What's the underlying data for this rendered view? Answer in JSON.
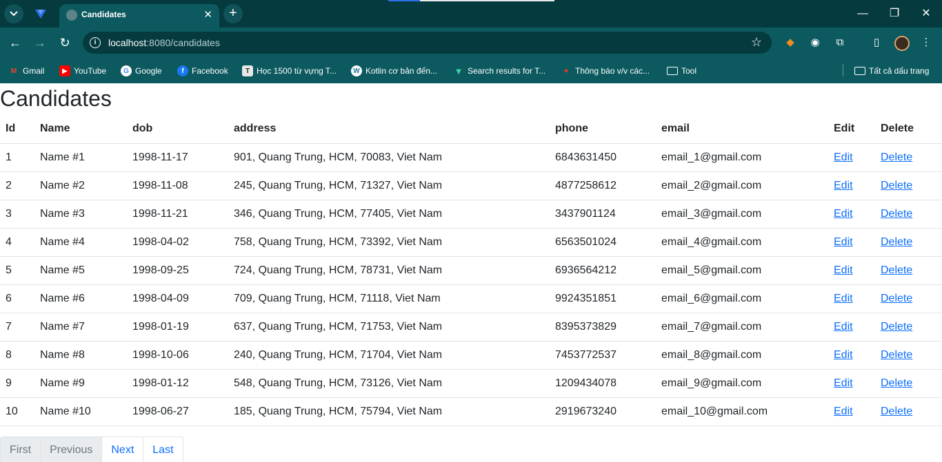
{
  "browser": {
    "tab_title": "Candidates",
    "url_host": "localhost",
    "url_rest": ":8080/candidates",
    "load_progress": 0.19,
    "bookmarks": [
      {
        "label": "Gmail",
        "icon": "gmail-icon"
      },
      {
        "label": "YouTube",
        "icon": "youtube-icon"
      },
      {
        "label": "Google",
        "icon": "google-icon"
      },
      {
        "label": "Facebook",
        "icon": "facebook-icon"
      },
      {
        "label": "Học 1500 từ vựng T...",
        "icon": "t-letter-icon"
      },
      {
        "label": "Kotlin cơ bản đến...",
        "icon": "wordpress-icon"
      },
      {
        "label": "Search results for T...",
        "icon": "v-logo-icon"
      },
      {
        "label": "Thông báo v/v các...",
        "icon": "red-logo-icon"
      },
      {
        "label": "Tool",
        "icon": "folder-icon"
      }
    ],
    "all_bookmarks": "Tất cả dấu trang"
  },
  "page": {
    "title": "Candidates",
    "columns": [
      "Id",
      "Name",
      "dob",
      "address",
      "phone",
      "email",
      "Edit",
      "Delete"
    ],
    "rows": [
      {
        "id": "1",
        "name": "Name #1",
        "dob": "1998-11-17",
        "address": "901, Quang Trung, HCM, 70083, Viet Nam",
        "phone": "6843631450",
        "email": "email_1@gmail.com",
        "edit": "Edit",
        "delete": "Delete"
      },
      {
        "id": "2",
        "name": "Name #2",
        "dob": "1998-11-08",
        "address": "245, Quang Trung, HCM, 71327, Viet Nam",
        "phone": "4877258612",
        "email": "email_2@gmail.com",
        "edit": "Edit",
        "delete": "Delete"
      },
      {
        "id": "3",
        "name": "Name #3",
        "dob": "1998-11-21",
        "address": "346, Quang Trung, HCM, 77405, Viet Nam",
        "phone": "3437901124",
        "email": "email_3@gmail.com",
        "edit": "Edit",
        "delete": "Delete"
      },
      {
        "id": "4",
        "name": "Name #4",
        "dob": "1998-04-02",
        "address": "758, Quang Trung, HCM, 73392, Viet Nam",
        "phone": "6563501024",
        "email": "email_4@gmail.com",
        "edit": "Edit",
        "delete": "Delete"
      },
      {
        "id": "5",
        "name": "Name #5",
        "dob": "1998-09-25",
        "address": "724, Quang Trung, HCM, 78731, Viet Nam",
        "phone": "6936564212",
        "email": "email_5@gmail.com",
        "edit": "Edit",
        "delete": "Delete"
      },
      {
        "id": "6",
        "name": "Name #6",
        "dob": "1998-04-09",
        "address": "709, Quang Trung, HCM, 71118, Viet Nam",
        "phone": "9924351851",
        "email": "email_6@gmail.com",
        "edit": "Edit",
        "delete": "Delete"
      },
      {
        "id": "7",
        "name": "Name #7",
        "dob": "1998-01-19",
        "address": "637, Quang Trung, HCM, 71753, Viet Nam",
        "phone": "8395373829",
        "email": "email_7@gmail.com",
        "edit": "Edit",
        "delete": "Delete"
      },
      {
        "id": "8",
        "name": "Name #8",
        "dob": "1998-10-06",
        "address": "240, Quang Trung, HCM, 71704, Viet Nam",
        "phone": "7453772537",
        "email": "email_8@gmail.com",
        "edit": "Edit",
        "delete": "Delete"
      },
      {
        "id": "9",
        "name": "Name #9",
        "dob": "1998-01-12",
        "address": "548, Quang Trung, HCM, 73126, Viet Nam",
        "phone": "1209434078",
        "email": "email_9@gmail.com",
        "edit": "Edit",
        "delete": "Delete"
      },
      {
        "id": "10",
        "name": "Name #10",
        "dob": "1998-06-27",
        "address": "185, Quang Trung, HCM, 75794, Viet Nam",
        "phone": "2919673240",
        "email": "email_10@gmail.com",
        "edit": "Edit",
        "delete": "Delete"
      }
    ],
    "pagination": [
      {
        "label": "First",
        "state": "disabled"
      },
      {
        "label": "Previous",
        "state": "disabled"
      },
      {
        "label": "Next",
        "state": "active"
      },
      {
        "label": "Last",
        "state": "active"
      }
    ]
  },
  "colors": {
    "chrome_dark": "#053b3f",
    "chrome_toolbar": "#0c5a5f",
    "link": "#0d6efd",
    "border": "#dee2e6"
  }
}
